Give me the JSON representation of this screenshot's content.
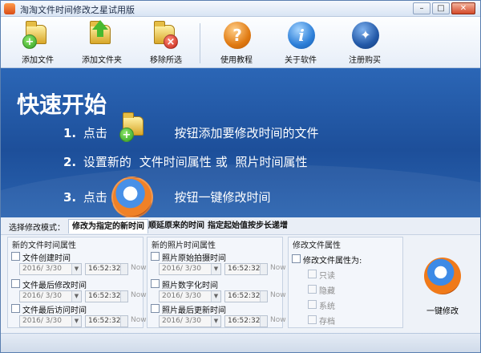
{
  "window": {
    "title": "淘淘文件时间修改之星试用版"
  },
  "toolbar": {
    "items": [
      {
        "label": "添加文件",
        "icon": "add-file-icon"
      },
      {
        "label": "添加文件夹",
        "icon": "add-folder-icon"
      },
      {
        "label": "移除所选",
        "icon": "remove-selected-icon"
      },
      {
        "label": "使用教程",
        "icon": "help-tutorial-icon"
      },
      {
        "label": "关于软件",
        "icon": "about-info-icon"
      },
      {
        "label": "注册购买",
        "icon": "register-buy-icon"
      }
    ]
  },
  "banner": {
    "title": "快速开始",
    "step1": {
      "num": "1.",
      "pre": "点击",
      "post": "按钮添加要修改时间的文件"
    },
    "step2": {
      "num": "2.",
      "pre": "设置新的",
      "a": "文件时间属性",
      "mid": "或",
      "b": "照片时间属性"
    },
    "step3": {
      "num": "3.",
      "pre": "点击",
      "post": "按钮一键修改时间"
    }
  },
  "mode": {
    "label": "选择修改模式：",
    "tabs": [
      "修改为指定的新时间",
      "顺延原来的时间",
      "指定起始值按步长递增"
    ],
    "active": 0
  },
  "file_panel": {
    "title": "新的文件时间属性",
    "rows": [
      {
        "label": "文件创建时间",
        "date": "2016/ 3/30",
        "time": "16:52:32",
        "now": "Now"
      },
      {
        "label": "文件最后修改时间",
        "date": "2016/ 3/30",
        "time": "16:52:32",
        "now": "Now"
      },
      {
        "label": "文件最后访问时间",
        "date": "2016/ 3/30",
        "time": "16:52:32",
        "now": "Now"
      }
    ]
  },
  "photo_panel": {
    "title": "新的照片时间属性",
    "rows": [
      {
        "label": "照片原始拍摄时间",
        "date": "2016/ 3/30",
        "time": "16:52:32",
        "now": "Now"
      },
      {
        "label": "照片数字化时间",
        "date": "2016/ 3/30",
        "time": "16:52:32",
        "now": "Now"
      },
      {
        "label": "照片最后更新时间",
        "date": "2016/ 3/30",
        "time": "16:52:32",
        "now": "Now"
      }
    ]
  },
  "attr_panel": {
    "title": "修改文件属性",
    "main": "修改文件属性为:",
    "options": [
      "只读",
      "隐藏",
      "系统",
      "存档"
    ]
  },
  "action": {
    "label": "一键修改"
  }
}
